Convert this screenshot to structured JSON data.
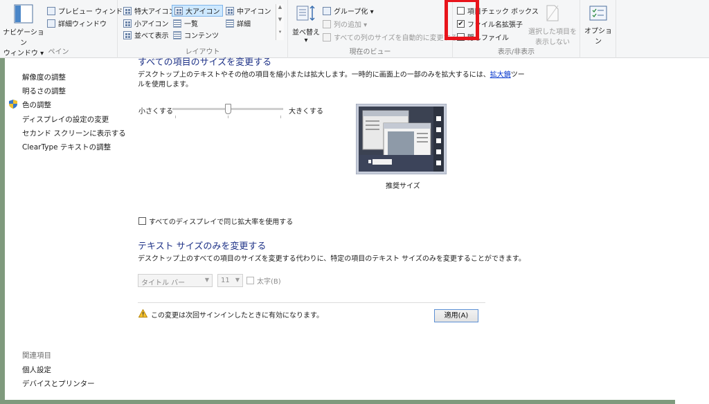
{
  "ribbon": {
    "pane": {
      "label": "ペイン",
      "nav_pane": "ナビゲーション",
      "nav_pane2": "ウィンドウ ▾",
      "preview": "プレビュー ウィンドウ",
      "details": "詳細ウィンドウ"
    },
    "layout": {
      "label": "レイアウト",
      "extra_large": "特大アイコン",
      "large": "大アイコン",
      "medium": "中アイコン",
      "small": "小アイコン",
      "list": "一覧",
      "details": "詳細",
      "tiles": "並べて表示",
      "content": "コンテンツ",
      "scroll_up": "▲",
      "scroll_down": "▼",
      "scroll_more": "▾"
    },
    "current_view": {
      "label": "現在のビュー",
      "sort": "並べ替え",
      "sort_arrow": "▾",
      "group": "グループ化 ▾",
      "add_column": "列の追加 ▾",
      "autofit": "すべての列のサイズを自動的に変更する"
    },
    "show_hide": {
      "label": "表示/非表示",
      "item_checkbox": "項目チェック ボックス",
      "extensions": "ファイル名拡張子",
      "extensions_checked": "✔",
      "hidden": "隠しファイル",
      "hide_selected_1": "選択した項目を",
      "hide_selected_2": "表示しない"
    },
    "options": "オプション"
  },
  "sidebar": {
    "links": [
      "解像度の調整",
      "明るさの調整",
      "色の調整",
      "ディスプレイの設定の変更",
      "セカンド スクリーンに表示する",
      "ClearType テキストの調整"
    ],
    "related_head": "関連項目",
    "related": [
      "個人設定",
      "デバイスとプリンター"
    ]
  },
  "main": {
    "title1": "すべての項目のサイズを変更する",
    "desc1a": "デスクトップ上のテキストやその他の項目を縮小または拡大します。一時的に画面上の一部のみを拡大するには、",
    "desc1_link": "拡大鏡",
    "desc1b": "ツー",
    "desc1c": "ルを使用します。",
    "slider_small": "小さくする",
    "slider_large": "大きくする",
    "slider_value": 0.5,
    "preview_caption": "推奨サイズ",
    "same_scale": "すべてのディスプレイで同じ拡大率を使用する",
    "title2": "テキスト サイズのみを変更する",
    "desc2": "デスクトップ上のすべての項目のサイズを変更する代わりに、特定の項目のテキスト サイズのみを変更することができます。",
    "item_select": "タイトル バー",
    "size_select": "11",
    "bold": "太字(B)",
    "warning": "この変更は次回サインインしたときに有効になります。",
    "apply": "適用(A)"
  },
  "colors": {
    "highlight": "#e8141b",
    "title": "#1e3287"
  }
}
